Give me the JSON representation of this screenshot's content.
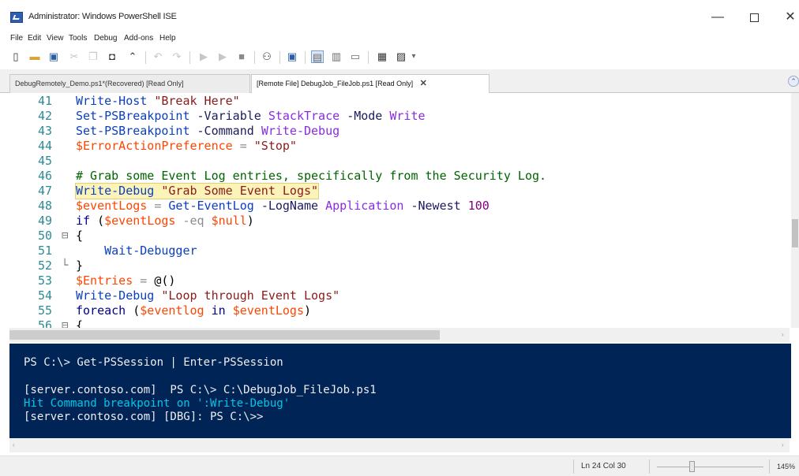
{
  "window": {
    "title": "Administrator: Windows PowerShell ISE",
    "minimize": "—",
    "close": "✕"
  },
  "menu": [
    "File",
    "Edit",
    "View",
    "Tools",
    "Debug",
    "Add-ons",
    "Help"
  ],
  "tabs": [
    {
      "label": "DebugRemotely_Demo.ps1*(Recovered) [Read Only]",
      "active": false
    },
    {
      "label": "[Remote File] DebugJob_FileJob.ps1 [Read Only]",
      "active": true,
      "close": "✕"
    }
  ],
  "editor": {
    "lines": [
      {
        "n": "41",
        "tokens": [
          [
            "cmd",
            "Write-Host"
          ],
          [
            "plain",
            " "
          ],
          [
            "str",
            "\"Break Here\""
          ]
        ]
      },
      {
        "n": "42",
        "tokens": [
          [
            "cmd",
            "Set-PSBreakpoint"
          ],
          [
            "plain",
            " "
          ],
          [
            "param",
            "-Variable"
          ],
          [
            "plain",
            " "
          ],
          [
            "arg",
            "StackTrace"
          ],
          [
            "plain",
            " "
          ],
          [
            "param",
            "-Mode"
          ],
          [
            "plain",
            " "
          ],
          [
            "arg",
            "Write"
          ]
        ]
      },
      {
        "n": "43",
        "tokens": [
          [
            "cmd",
            "Set-PSBreakpoint"
          ],
          [
            "plain",
            " "
          ],
          [
            "param",
            "-Command"
          ],
          [
            "plain",
            " "
          ],
          [
            "arg",
            "Write-Debug"
          ]
        ]
      },
      {
        "n": "44",
        "tokens": [
          [
            "var",
            "$ErrorActionPreference"
          ],
          [
            "plain",
            " "
          ],
          [
            "op",
            "="
          ],
          [
            "plain",
            " "
          ],
          [
            "str",
            "\"Stop\""
          ]
        ]
      },
      {
        "n": "45",
        "tokens": []
      },
      {
        "n": "46",
        "tokens": [
          [
            "cmt",
            "# Grab some Event Log entries, specifically from the Security Log."
          ]
        ]
      },
      {
        "n": "47",
        "highlight": true,
        "tokens": [
          [
            "cmd",
            "Write-Debug"
          ],
          [
            "plain",
            " "
          ],
          [
            "str",
            "\"Grab Some Event Logs\""
          ]
        ]
      },
      {
        "n": "48",
        "tokens": [
          [
            "var",
            "$eventLogs"
          ],
          [
            "plain",
            " "
          ],
          [
            "op",
            "="
          ],
          [
            "plain",
            " "
          ],
          [
            "cmd",
            "Get-EventLog"
          ],
          [
            "plain",
            " "
          ],
          [
            "param",
            "-LogName"
          ],
          [
            "plain",
            " "
          ],
          [
            "arg",
            "Application"
          ],
          [
            "plain",
            " "
          ],
          [
            "param",
            "-Newest"
          ],
          [
            "plain",
            " "
          ],
          [
            "num",
            "100"
          ]
        ]
      },
      {
        "n": "49",
        "tokens": [
          [
            "kw",
            "if"
          ],
          [
            "plain",
            " ("
          ],
          [
            "var",
            "$eventLogs"
          ],
          [
            "plain",
            " "
          ],
          [
            "op",
            "-eq"
          ],
          [
            "plain",
            " "
          ],
          [
            "var",
            "$null"
          ],
          [
            "plain",
            ")"
          ]
        ]
      },
      {
        "n": "50",
        "fold": "⊟",
        "tokens": [
          [
            "plain",
            "{"
          ]
        ]
      },
      {
        "n": "51",
        "tokens": [
          [
            "plain",
            "    "
          ],
          [
            "cmd",
            "Wait-Debugger"
          ]
        ]
      },
      {
        "n": "52",
        "fold": "└",
        "tokens": [
          [
            "plain",
            "}"
          ]
        ]
      },
      {
        "n": "53",
        "tokens": [
          [
            "var",
            "$Entries"
          ],
          [
            "plain",
            " "
          ],
          [
            "op",
            "="
          ],
          [
            "plain",
            " @()"
          ]
        ]
      },
      {
        "n": "54",
        "tokens": [
          [
            "cmd",
            "Write-Debug"
          ],
          [
            "plain",
            " "
          ],
          [
            "str",
            "\"Loop through Event Logs\""
          ]
        ]
      },
      {
        "n": "55",
        "tokens": [
          [
            "kw",
            "foreach"
          ],
          [
            "plain",
            " ("
          ],
          [
            "var",
            "$eventlog"
          ],
          [
            "plain",
            " "
          ],
          [
            "kw",
            "in"
          ],
          [
            "plain",
            " "
          ],
          [
            "var",
            "$eventLogs"
          ],
          [
            "plain",
            ")"
          ]
        ]
      },
      {
        "n": "56",
        "fold": "⊟",
        "tokens": [
          [
            "plain",
            "{"
          ]
        ]
      }
    ]
  },
  "console": {
    "lines": [
      {
        "text": "PS C:\\> Get-PSSession | Enter-PSSession",
        "color": "normal"
      },
      {
        "text": "[server.contoso.com]  PS C:\\> C:\\DebugJob_FileJob.ps1",
        "color": "normal"
      },
      {
        "text": "Hit Command breakpoint on ':Write-Debug'",
        "color": "cyan"
      },
      {
        "text": "[server.contoso.com] [DBG]: PS C:\\>>",
        "color": "normal"
      }
    ]
  },
  "status": {
    "position": "Ln 24  Col 30",
    "zoom": "145%",
    "zoom_level_percent": 145
  }
}
